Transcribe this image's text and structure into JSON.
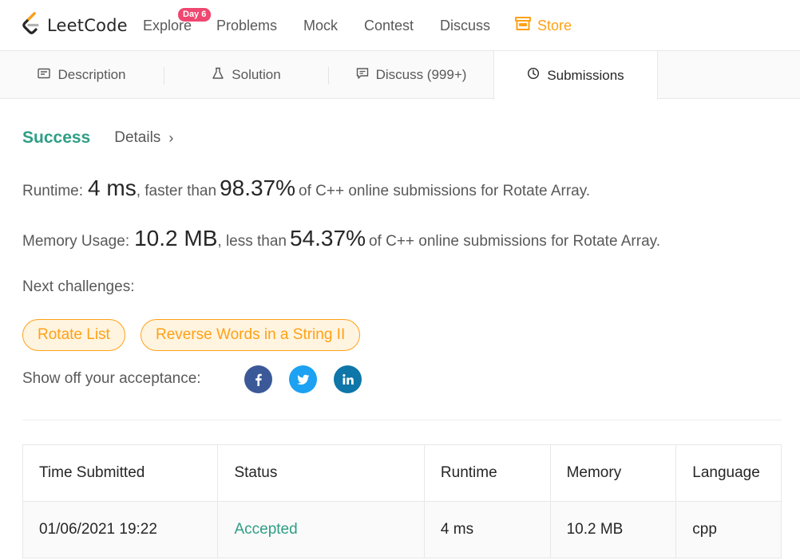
{
  "brand": {
    "name": "LeetCode",
    "logo_icon": "leetcode-logo-icon"
  },
  "nav": {
    "items": [
      {
        "label": "Explore"
      },
      {
        "label": "Problems"
      },
      {
        "label": "Mock"
      },
      {
        "label": "Contest"
      },
      {
        "label": "Discuss"
      }
    ],
    "badge": "Day 6",
    "store_label": "Store",
    "store_icon": "store-icon"
  },
  "tabs": [
    {
      "label": "Description",
      "icon": "description-icon"
    },
    {
      "label": "Solution",
      "icon": "flask-icon"
    },
    {
      "label": "Discuss (999+)",
      "icon": "comment-icon"
    },
    {
      "label": "Submissions",
      "icon": "clock-icon",
      "active": true
    }
  ],
  "result": {
    "status": "Success",
    "details_label": "Details",
    "details_chevron": "›",
    "runtime": {
      "label": "Runtime:",
      "value": "4 ms",
      "comparison": ", faster than",
      "percent": "98.37%",
      "suffix": "of C++ online submissions for Rotate Array."
    },
    "memory": {
      "label": "Memory Usage:",
      "value": "10.2 MB",
      "comparison": ", less than",
      "percent": "54.37%",
      "suffix": "of C++ online submissions for Rotate Array."
    },
    "next_label": "Next challenges:",
    "challenges": [
      "Rotate List",
      "Reverse Words in a String II"
    ],
    "share_label": "Show off your acceptance:",
    "social": [
      "facebook-icon",
      "twitter-icon",
      "linkedin-icon"
    ]
  },
  "submissions": {
    "columns": [
      "Time Submitted",
      "Status",
      "Runtime",
      "Memory",
      "Language"
    ],
    "rows": [
      {
        "time": "01/06/2021 19:22",
        "status": "Accepted",
        "runtime": "4 ms",
        "memory": "10.2 MB",
        "language": "cpp"
      }
    ]
  },
  "colors": {
    "accent": "#ffa116",
    "success": "#2e9e85",
    "badge": "#ef476f",
    "facebook": "#3b5998",
    "twitter": "#1da1f2",
    "linkedin": "#0e76a8"
  }
}
